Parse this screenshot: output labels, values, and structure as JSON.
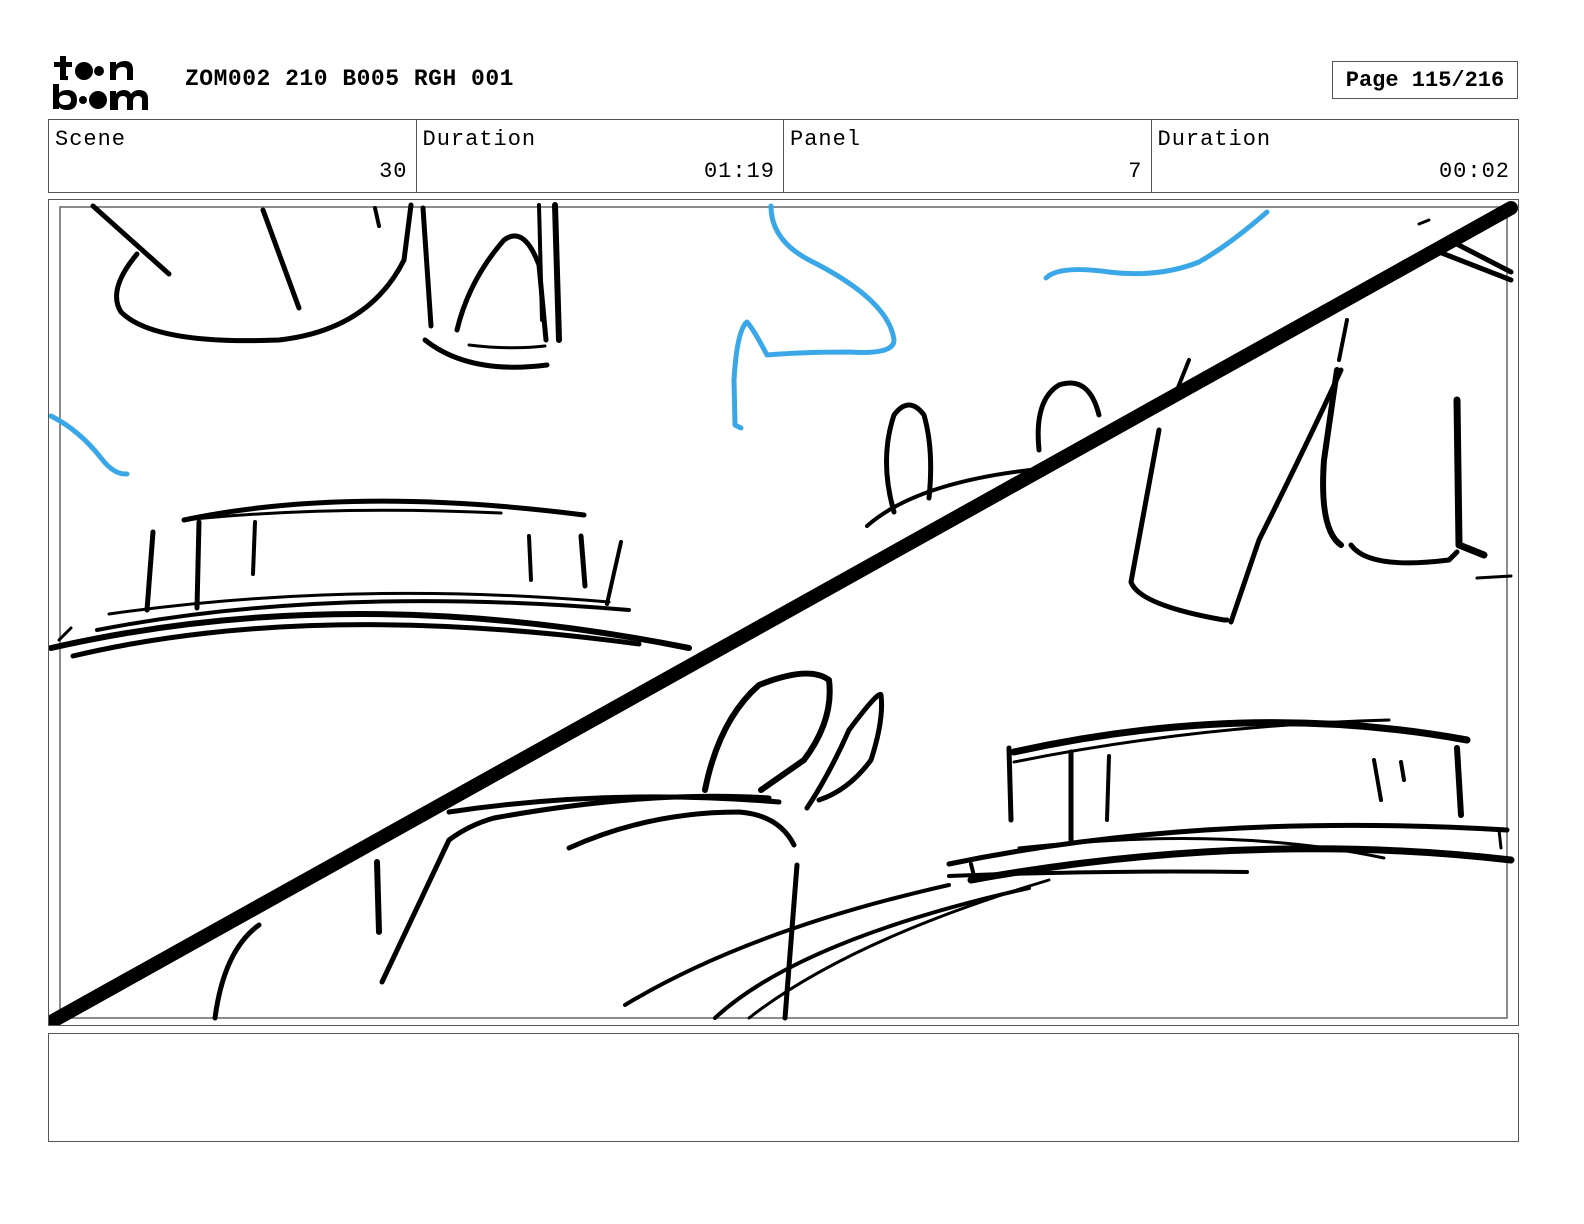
{
  "header": {
    "logo_name": "toon-boom-logo",
    "title": "ZOM002 210 B005 RGH 001",
    "page_label": "Page 115/216"
  },
  "info": {
    "scene_label": "Scene",
    "scene_value": "30",
    "scene_duration_label": "Duration",
    "scene_duration_value": "01:19",
    "panel_label": "Panel",
    "panel_value": "7",
    "panel_duration_label": "Duration",
    "panel_duration_value": "00:02"
  },
  "sketch": {
    "line_color": "#000000",
    "accent_color": "#3aa8e8"
  },
  "notes": {
    "text": ""
  }
}
